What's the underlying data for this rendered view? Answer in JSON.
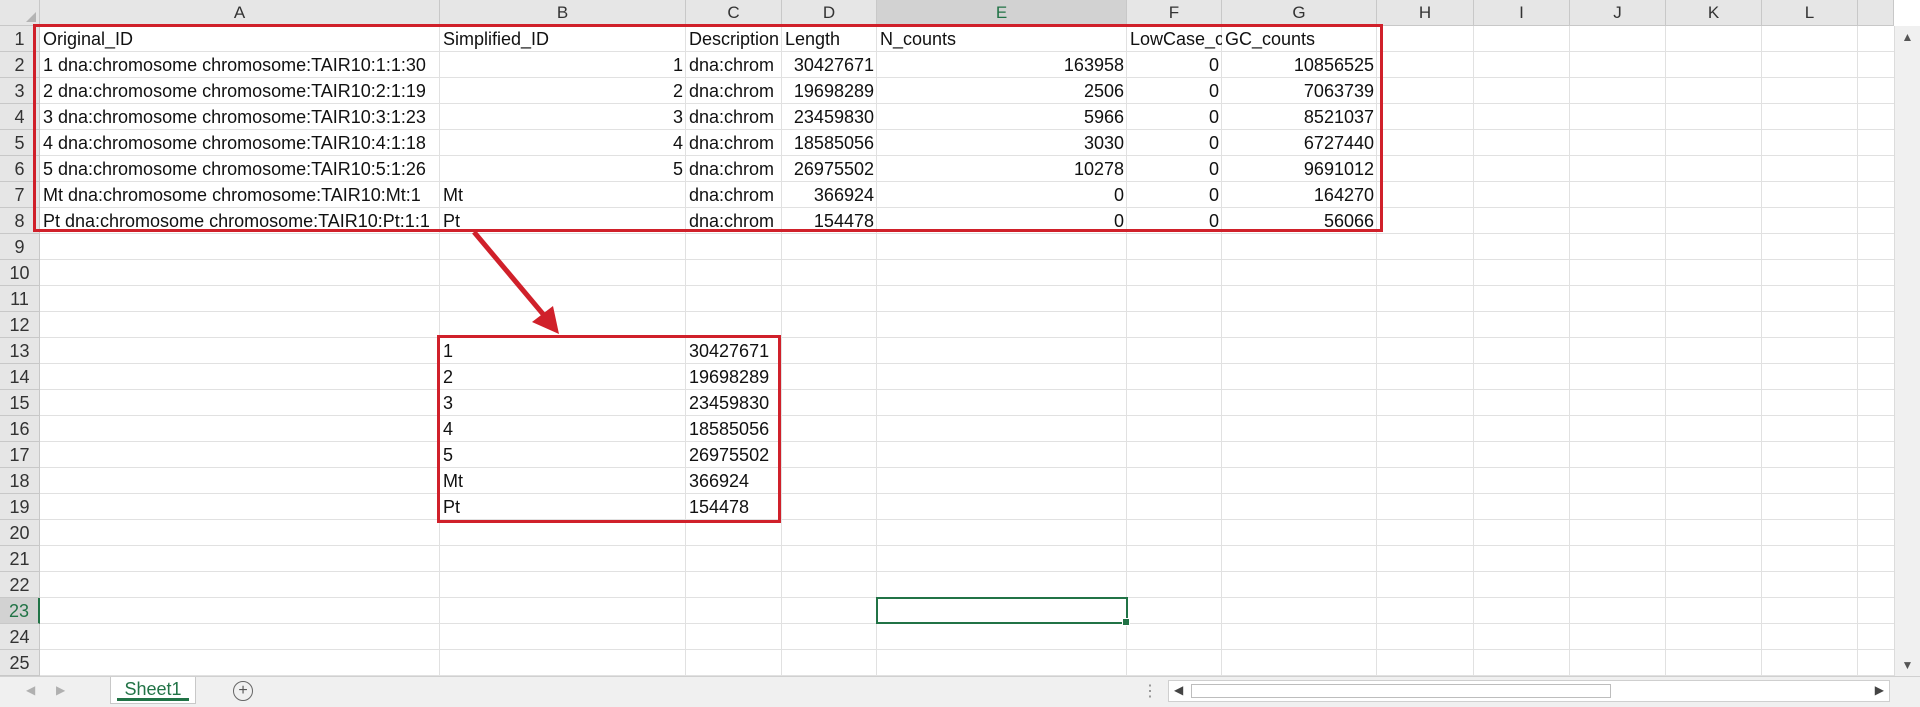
{
  "columns": [
    "A",
    "B",
    "C",
    "D",
    "E",
    "F",
    "G",
    "H",
    "I",
    "J",
    "K",
    "L"
  ],
  "selected_column": "E",
  "selected_row": "23",
  "rows": [
    "1",
    "2",
    "3",
    "4",
    "5",
    "6",
    "7",
    "8",
    "9",
    "10",
    "11",
    "12",
    "13",
    "14",
    "15",
    "16",
    "17",
    "18",
    "19",
    "20",
    "21",
    "22",
    "23",
    "24",
    "25"
  ],
  "header_row": {
    "A": "Original_ID",
    "B": "Simplified_ID",
    "C": "Description",
    "D": "Length",
    "E": "N_counts",
    "F": "LowCase_c",
    "G": "GC_counts"
  },
  "data_rows": [
    {
      "A": "1 dna:chromosome chromosome:TAIR10:1:1:30",
      "B": "1",
      "C": "dna:chrom",
      "D": "30427671",
      "E": "163958",
      "F": "0",
      "G": "10856525"
    },
    {
      "A": "2 dna:chromosome chromosome:TAIR10:2:1:19",
      "B": "2",
      "C": "dna:chrom",
      "D": "19698289",
      "E": "2506",
      "F": "0",
      "G": "7063739"
    },
    {
      "A": "3 dna:chromosome chromosome:TAIR10:3:1:23",
      "B": "3",
      "C": "dna:chrom",
      "D": "23459830",
      "E": "5966",
      "F": "0",
      "G": "8521037"
    },
    {
      "A": "4 dna:chromosome chromosome:TAIR10:4:1:18",
      "B": "4",
      "C": "dna:chrom",
      "D": "18585056",
      "E": "3030",
      "F": "0",
      "G": "6727440"
    },
    {
      "A": "5 dna:chromosome chromosome:TAIR10:5:1:26",
      "B": "5",
      "C": "dna:chrom",
      "D": "26975502",
      "E": "10278",
      "F": "0",
      "G": "9691012"
    },
    {
      "A": "Mt dna:chromosome chromosome:TAIR10:Mt:1",
      "B": "Mt",
      "C": "dna:chrom",
      "D": "366924",
      "E": "0",
      "F": "0",
      "G": "164270"
    },
    {
      "A": "Pt dna:chromosome chromosome:TAIR10:Pt:1:1",
      "B": "Pt",
      "C": "dna:chrom",
      "D": "154478",
      "E": "0",
      "F": "0",
      "G": "56066"
    }
  ],
  "lower_table": [
    {
      "B": "1",
      "C": "30427671"
    },
    {
      "B": "2",
      "C": "19698289"
    },
    {
      "B": "3",
      "C": "23459830"
    },
    {
      "B": "4",
      "C": "18585056"
    },
    {
      "B": "5",
      "C": "26975502"
    },
    {
      "B": "Mt",
      "C": "366924"
    },
    {
      "B": "Pt",
      "C": "154478"
    }
  ],
  "sheet_tab": "Sheet1",
  "add_sheet_label": "+",
  "overflow_dots": "⋮",
  "colors": {
    "annotation": "#d0202a",
    "accent": "#217346"
  }
}
